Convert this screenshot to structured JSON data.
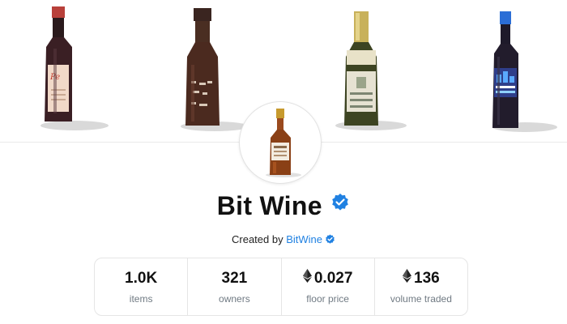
{
  "collection": {
    "name": "Bit Wine",
    "created_by_prefix": "Created by ",
    "creator": "BitWine"
  },
  "stats": [
    {
      "value": "1.0K",
      "label": "items",
      "eth": false
    },
    {
      "value": "321",
      "label": "owners",
      "eth": false
    },
    {
      "value": "0.027",
      "label": "floor price",
      "eth": true
    },
    {
      "value": "136",
      "label": "volume traded",
      "eth": true
    }
  ],
  "colors": {
    "verified": "#2081e2",
    "link": "#2081e2",
    "label": "#707a83",
    "border": "#e5e5e5"
  },
  "icons": {
    "verified": "verified-badge-icon",
    "currency": "ethereum-icon"
  }
}
